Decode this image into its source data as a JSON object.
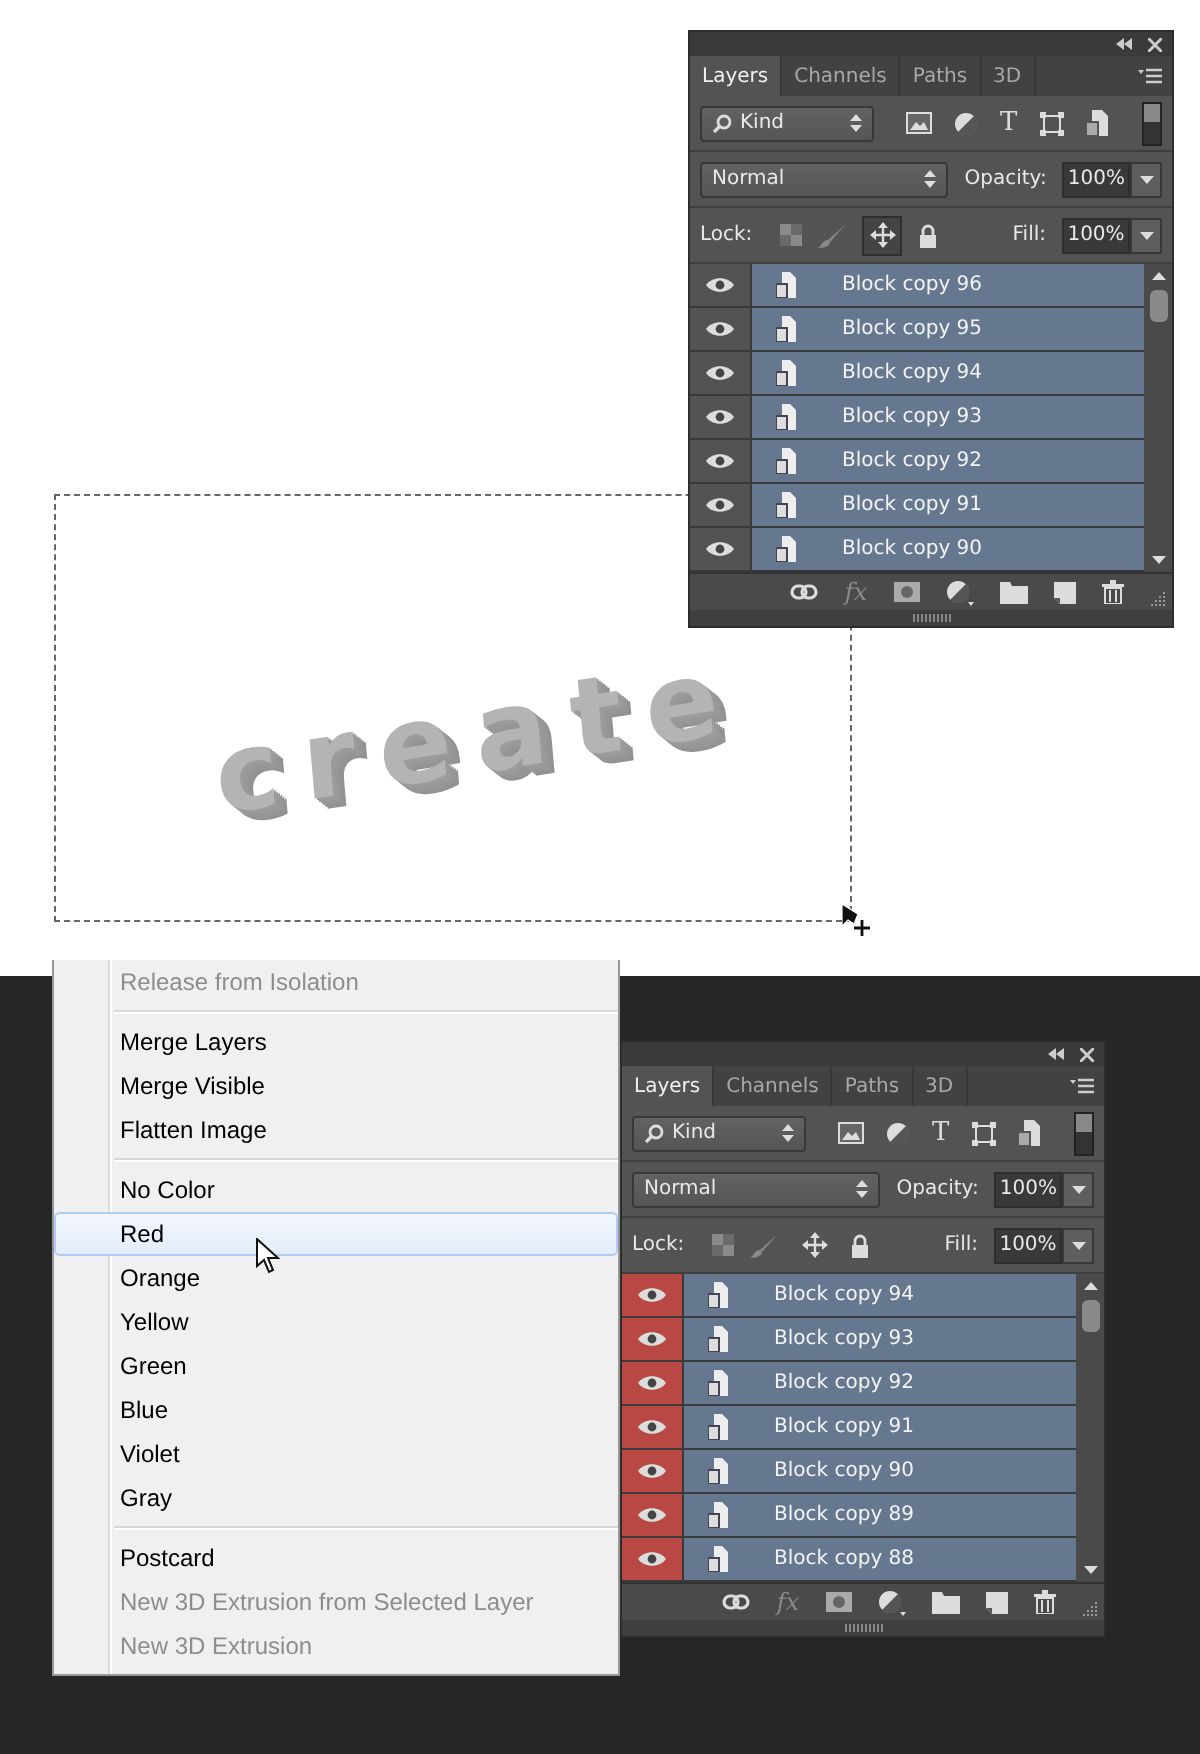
{
  "canvas": {
    "text": "create"
  },
  "panels": [
    {
      "tabs": [
        {
          "label": "Layers",
          "selected": true
        },
        {
          "label": "Channels",
          "selected": false
        },
        {
          "label": "Paths",
          "selected": false
        },
        {
          "label": "3D",
          "selected": false
        }
      ],
      "filter": "Kind",
      "type_glyph": "T",
      "blend_mode": "Normal",
      "opacity_label": "Opacity:",
      "opacity": "100%",
      "lock_label": "Lock:",
      "position_lock_on": true,
      "fill_label": "Fill:",
      "fill": "100%",
      "fx_glyph": "fx",
      "layers": [
        {
          "name": "Block copy 96",
          "visible": true
        },
        {
          "name": "Block copy 95",
          "visible": true
        },
        {
          "name": "Block copy 94",
          "visible": true
        },
        {
          "name": "Block copy 93",
          "visible": true
        },
        {
          "name": "Block copy 92",
          "visible": true
        },
        {
          "name": "Block copy 91",
          "visible": true
        },
        {
          "name": "Block copy 90",
          "visible": true
        }
      ]
    },
    {
      "tabs": [
        {
          "label": "Layers",
          "selected": true
        },
        {
          "label": "Channels",
          "selected": false
        },
        {
          "label": "Paths",
          "selected": false
        },
        {
          "label": "3D",
          "selected": false
        }
      ],
      "filter": "Kind",
      "type_glyph": "T",
      "blend_mode": "Normal",
      "opacity_label": "Opacity:",
      "opacity": "100%",
      "lock_label": "Lock:",
      "position_lock_on": false,
      "fill_label": "Fill:",
      "fill": "100%",
      "fx_glyph": "fx",
      "layers": [
        {
          "name": "Block copy 94",
          "visible": true,
          "color": "#b94744"
        },
        {
          "name": "Block copy 93",
          "visible": true,
          "color": "#b94744"
        },
        {
          "name": "Block copy 92",
          "visible": true,
          "color": "#b94744"
        },
        {
          "name": "Block copy 91",
          "visible": true,
          "color": "#b94744"
        },
        {
          "name": "Block copy 90",
          "visible": true,
          "color": "#b94744"
        },
        {
          "name": "Block copy 89",
          "visible": true,
          "color": "#b94744"
        },
        {
          "name": "Block copy 88",
          "visible": true,
          "color": "#b94744"
        }
      ]
    }
  ],
  "context_menu": {
    "groups": [
      [
        {
          "label": "Release from Isolation",
          "disabled": true,
          "highlighted": false
        }
      ],
      [
        {
          "label": "Merge Layers",
          "disabled": false,
          "highlighted": false
        },
        {
          "label": "Merge Visible",
          "disabled": false,
          "highlighted": false
        },
        {
          "label": "Flatten Image",
          "disabled": false,
          "highlighted": false
        }
      ],
      [
        {
          "label": "No Color",
          "disabled": false,
          "highlighted": false
        },
        {
          "label": "Red",
          "disabled": false,
          "highlighted": true
        },
        {
          "label": "Orange",
          "disabled": false,
          "highlighted": false
        },
        {
          "label": "Yellow",
          "disabled": false,
          "highlighted": false
        },
        {
          "label": "Green",
          "disabled": false,
          "highlighted": false
        },
        {
          "label": "Blue",
          "disabled": false,
          "highlighted": false
        },
        {
          "label": "Violet",
          "disabled": false,
          "highlighted": false
        },
        {
          "label": "Gray",
          "disabled": false,
          "highlighted": false
        }
      ],
      [
        {
          "label": "Postcard",
          "disabled": false,
          "highlighted": false
        },
        {
          "label": "New 3D Extrusion from Selected Layer",
          "disabled": true,
          "highlighted": false
        },
        {
          "label": "New 3D Extrusion",
          "disabled": true,
          "highlighted": false
        }
      ]
    ]
  }
}
